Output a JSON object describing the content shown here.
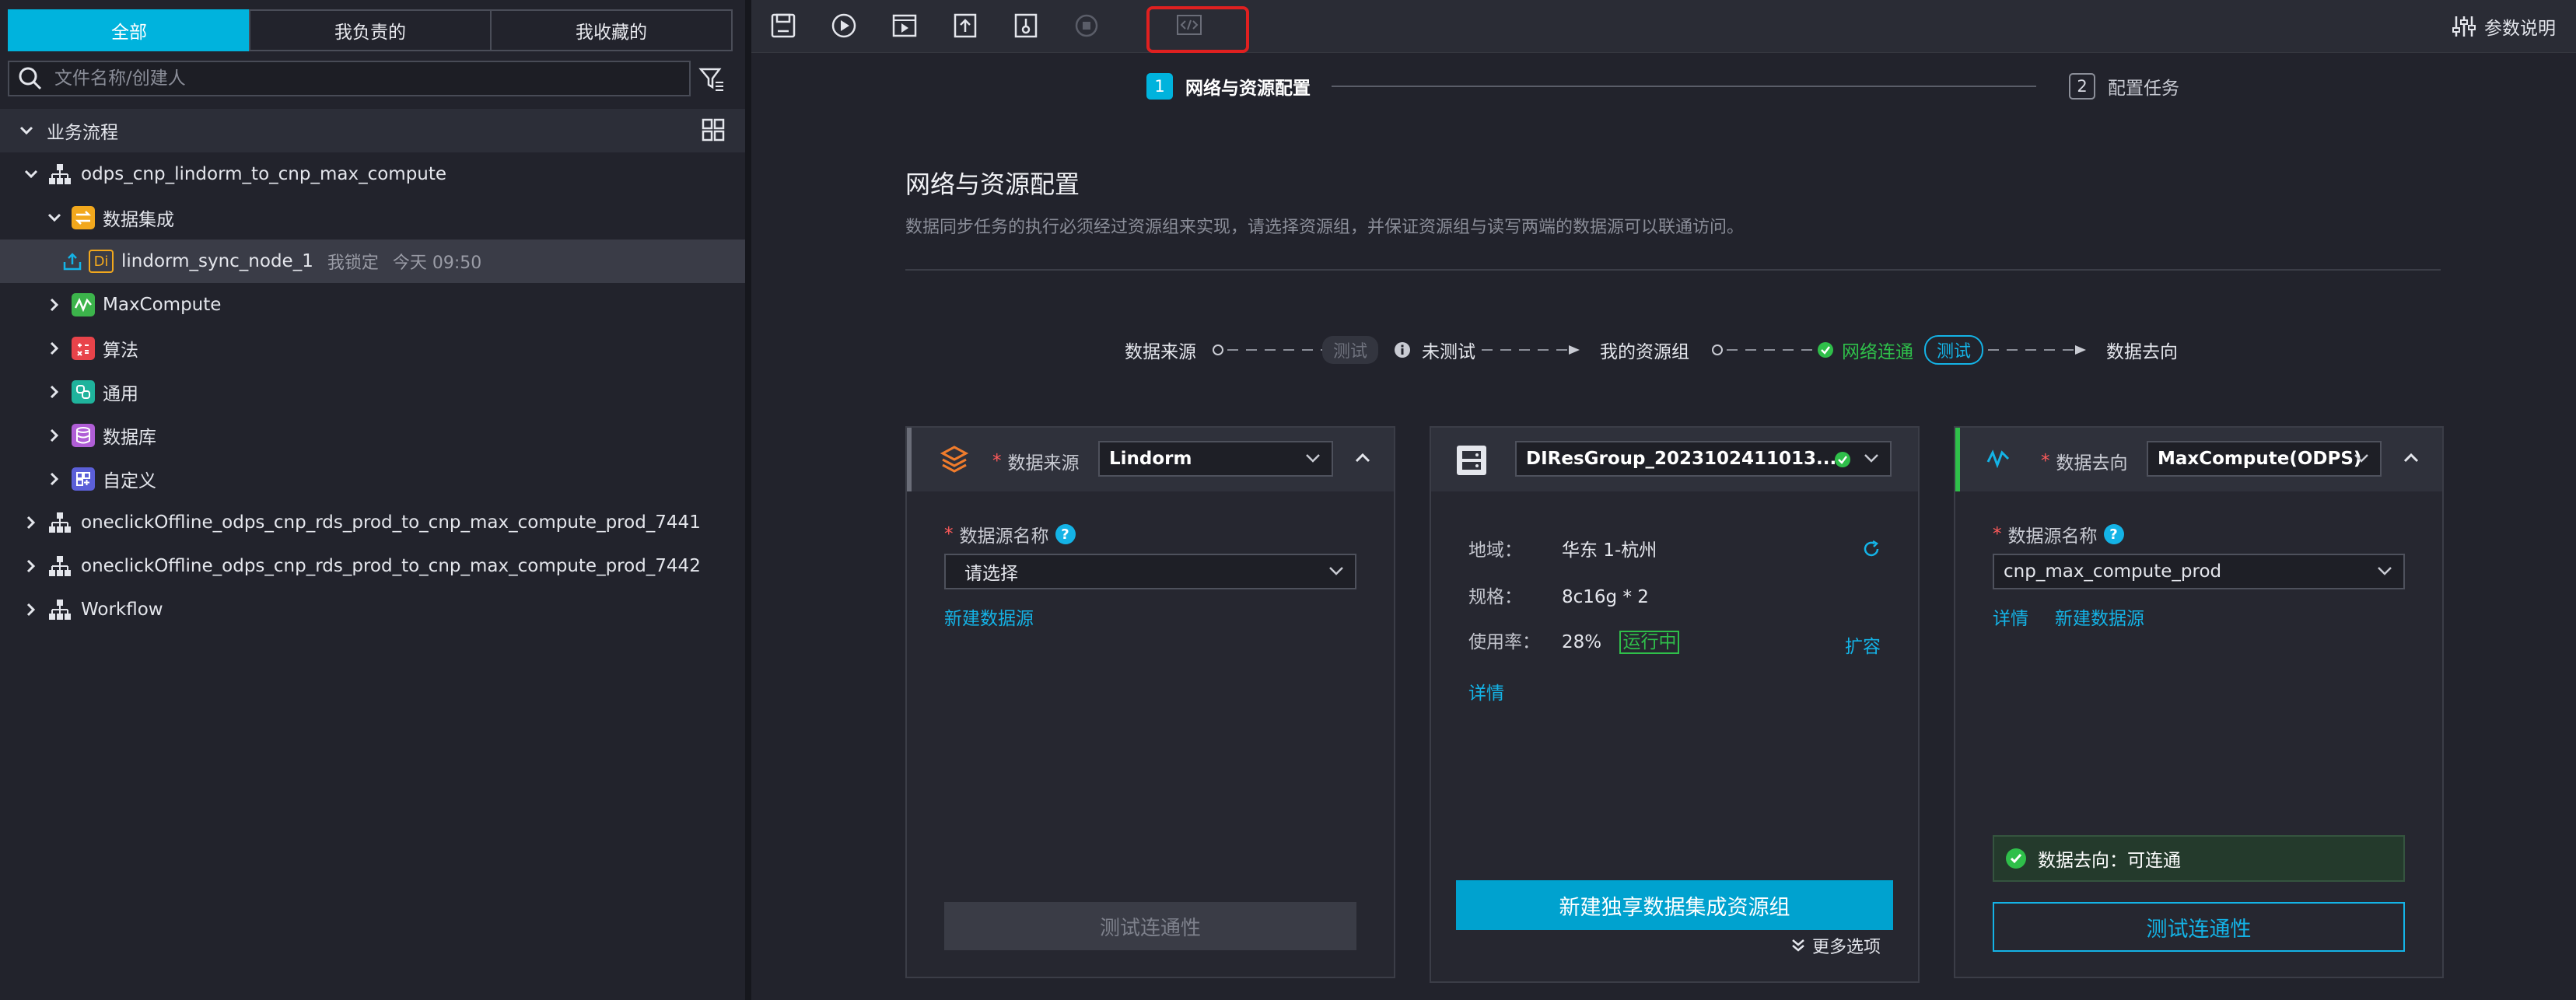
{
  "left_panel": {
    "tabs": [
      "全部",
      "我负责的",
      "我收藏的"
    ],
    "search_placeholder": "文件名称/创建人",
    "group_title": "业务流程",
    "tree": {
      "flow1": "odps_cnp_lindorm_to_cnp_max_compute",
      "data_integration": "数据集成",
      "node": {
        "badge": "Di",
        "name": "lindorm_sync_node_1",
        "lock": "我锁定",
        "time": "今天 09:50"
      },
      "maxcompute": "MaxCompute",
      "algorithm": "算法",
      "general": "通用",
      "database": "数据库",
      "custom": "自定义",
      "flow2": "oneclickOffline_odps_cnp_rds_prod_to_cnp_max_compute_prod_7441",
      "flow3": "oneclickOffline_odps_cnp_rds_prod_to_cnp_max_compute_prod_7442",
      "flow4": "Workflow"
    }
  },
  "toolbar": {
    "param_doc": "参数说明",
    "icons": [
      "save-icon",
      "run-icon",
      "run-with-params-icon",
      "submit-icon",
      "publish-icon",
      "stop-icon",
      "code-view-icon"
    ]
  },
  "steps": [
    {
      "num": "1",
      "label": "网络与资源配置"
    },
    {
      "num": "2",
      "label": "配置任务"
    }
  ],
  "section": {
    "title": "网络与资源配置",
    "desc": "数据同步任务的执行必须经过资源组来实现，请选择资源组，并保证资源组与读写两端的数据源可以联通访问。"
  },
  "flow_status": {
    "source": "数据来源",
    "test1": "测试",
    "untested": "未测试",
    "my_group": "我的资源组",
    "connected": "网络连通",
    "test2": "测试",
    "dest": "数据去向"
  },
  "source_card": {
    "label": "数据来源",
    "type": "Lindorm",
    "ds_name_label": "数据源名称",
    "ds_placeholder": "请选择",
    "new_ds": "新建数据源",
    "test_btn": "测试连通性"
  },
  "group_card": {
    "name": "DIResGroup_2023102411013...",
    "region_label": "地域：",
    "region": "华东 1-杭州",
    "spec_label": "规格：",
    "spec": "8c16g * 2",
    "usage_label": "使用率：",
    "usage": "28%",
    "status": "运行中",
    "expand": "扩容",
    "details": "详情",
    "new_group_btn": "新建独享数据集成资源组",
    "more": "更多选项"
  },
  "dest_card": {
    "label": "数据去向",
    "type": "MaxCompute(ODPS)",
    "ds_name_label": "数据源名称",
    "ds_value": "cnp_max_compute_prod",
    "details": "详情",
    "new_ds": "新建数据源",
    "status": "数据去向：可连通",
    "test_btn": "测试连通性"
  },
  "colors": {
    "accent": "#00b3dd",
    "link": "#14b3e6",
    "success": "#2fbf4a",
    "highlight_box": "#e02020"
  }
}
